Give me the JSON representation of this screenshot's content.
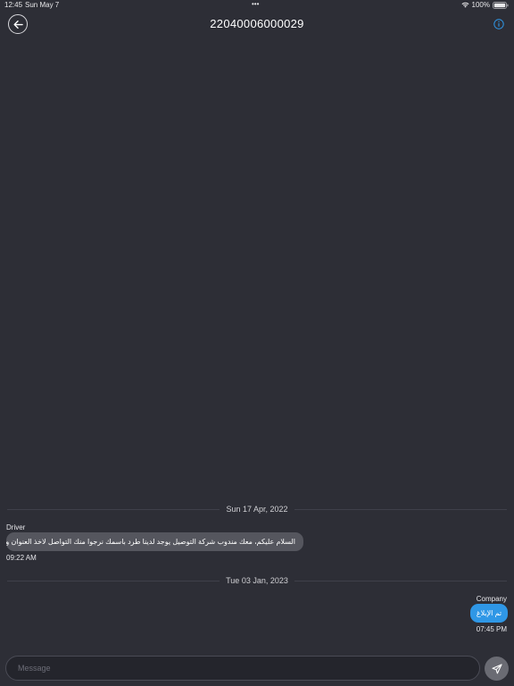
{
  "status_bar": {
    "time": "12:45",
    "date": "Sun May 7",
    "dots": "•••",
    "battery": "100%"
  },
  "header": {
    "title": "22040006000029",
    "back_icon": "arrow-left-icon",
    "info_icon": "info-circle-icon"
  },
  "messages": [
    {
      "date_separator": "Sun 17 Apr, 2022",
      "sender": "Driver",
      "text": "السلام عليكم، معك مندوب شركة التوصيل يوجد لدينا طرد باسمك نرجوا منك التواصل لاخذ العنوان وتحديد وقت التسليم",
      "time": "09:22 AM"
    },
    {
      "date_separator": "Tue 03 Jan, 2023",
      "sender": "Company",
      "text": "تم الإبلاغ",
      "time": "07:45 PM"
    }
  ],
  "composer": {
    "placeholder": "Message",
    "send_icon": "send-icon"
  },
  "colors": {
    "background": "#2d2e36",
    "incoming_bubble": "#55565e",
    "outgoing_bubble": "#2f97e6",
    "accent": "#2f97e6",
    "send_button": "#6a6b73"
  }
}
